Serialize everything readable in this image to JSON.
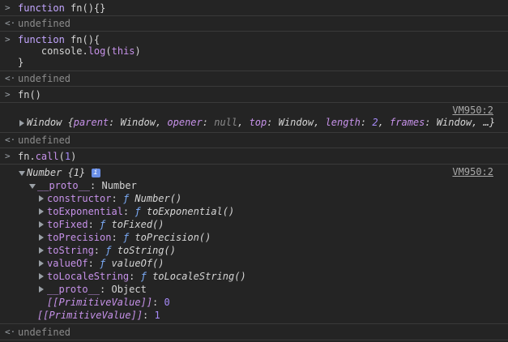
{
  "entries": {
    "e1": {
      "code": [
        "function",
        "fn",
        "(){}"
      ]
    },
    "r1": {
      "result": "undefined"
    },
    "e2": {
      "line1": [
        "function",
        "fn",
        "(){"
      ],
      "line2": [
        "    console.",
        "log",
        "(",
        "this",
        ")"
      ],
      "line3": "}"
    },
    "r2": {
      "result": "undefined"
    },
    "e3": {
      "code": "fn()"
    },
    "log1": {
      "source": "VM950:2",
      "text": [
        "Window {",
        "parent",
        ": Window, ",
        "opener",
        ": ",
        "null",
        ", ",
        "top",
        ": Window, ",
        "length",
        ": ",
        "2",
        ", ",
        "frames",
        ": Window, …}"
      ]
    },
    "r3": {
      "result": "undefined"
    },
    "e4": {
      "code": [
        "fn.",
        "call",
        "(",
        "1",
        ")"
      ]
    },
    "log2": {
      "source": "VM950:2",
      "header": [
        "Number ",
        "{1}"
      ],
      "info_label": "i",
      "proto_header": [
        "__proto__",
        ": Number"
      ],
      "props": [
        {
          "key": "constructor",
          "val": "Number()"
        },
        {
          "key": "toExponential",
          "val": "toExponential()"
        },
        {
          "key": "toFixed",
          "val": "toFixed()"
        },
        {
          "key": "toPrecision",
          "val": "toPrecision()"
        },
        {
          "key": "toString",
          "val": "toString()"
        },
        {
          "key": "valueOf",
          "val": "valueOf()"
        },
        {
          "key": "toLocaleString",
          "val": "toLocaleString()"
        }
      ],
      "inner_proto": [
        "__proto__",
        ": Object"
      ],
      "primitive_inner": [
        "[[PrimitiveValue]]",
        ": ",
        "0"
      ],
      "primitive_outer": [
        "[[PrimitiveValue]]",
        ": ",
        "1"
      ],
      "f_glyph": "ƒ"
    },
    "r4": {
      "result": "undefined"
    }
  },
  "prefixes": {
    "input": ">",
    "output": "<·"
  }
}
